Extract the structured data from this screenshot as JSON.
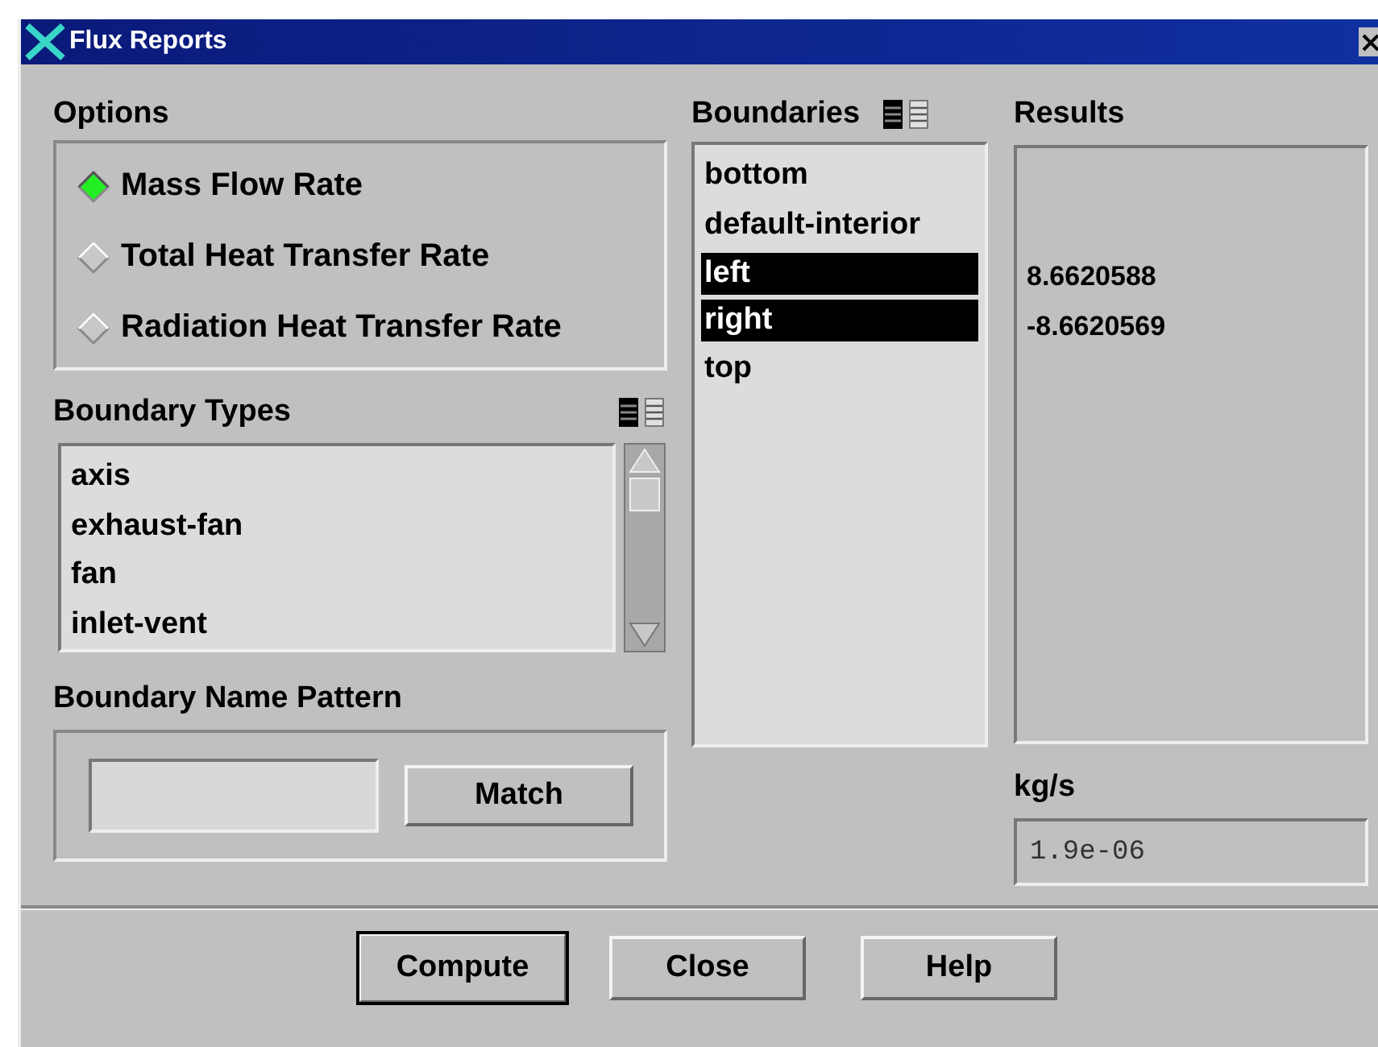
{
  "window": {
    "title": "Flux Reports"
  },
  "options": {
    "label": "Options",
    "items": [
      {
        "label": "Mass Flow Rate",
        "selected": true
      },
      {
        "label": "Total Heat Transfer Rate",
        "selected": false
      },
      {
        "label": "Radiation Heat Transfer Rate",
        "selected": false
      }
    ]
  },
  "boundary_types": {
    "label": "Boundary Types",
    "items": [
      {
        "label": "axis",
        "selected": false
      },
      {
        "label": "exhaust-fan",
        "selected": false
      },
      {
        "label": "fan",
        "selected": false
      },
      {
        "label": "inlet-vent",
        "selected": false
      }
    ]
  },
  "boundary_name_pattern": {
    "label": "Boundary Name Pattern",
    "button": "Match"
  },
  "boundaries": {
    "label": "Boundaries",
    "items": [
      {
        "label": "bottom",
        "selected": false
      },
      {
        "label": "default-interior",
        "selected": false
      },
      {
        "label": "left",
        "selected": true
      },
      {
        "label": "right",
        "selected": true
      },
      {
        "label": "top",
        "selected": false
      }
    ]
  },
  "results": {
    "label": "Results",
    "values": [
      "8.6620588",
      "-8.6620569"
    ],
    "unit": "kg/s",
    "net": "1.9e-06"
  },
  "buttons": [
    "Compute",
    "Close",
    "Help"
  ]
}
